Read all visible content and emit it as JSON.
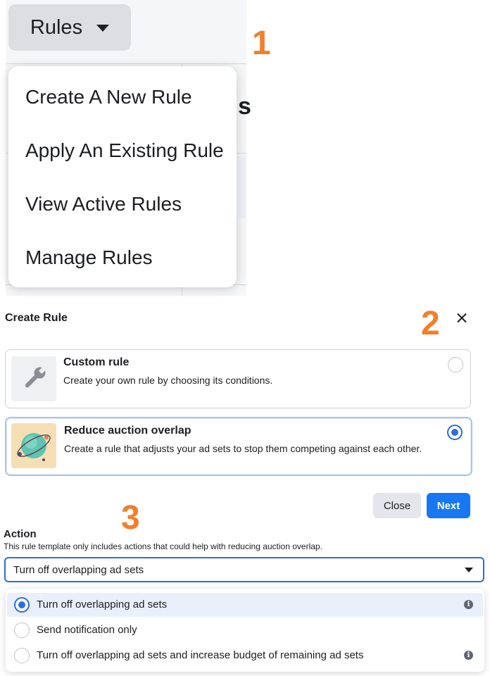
{
  "rules_menu": {
    "button_label": "Rules",
    "items": [
      "Create A New Rule",
      "Apply An Existing Rule",
      "View Active Rules",
      "Manage Rules"
    ],
    "partial_background_glyph": "s"
  },
  "step_numbers": [
    "1",
    "2",
    "3"
  ],
  "create_rule_modal": {
    "title": "Create Rule",
    "options": [
      {
        "title": "Custom rule",
        "description": "Create your own rule by choosing its conditions.",
        "icon": "wrench-icon",
        "selected": false
      },
      {
        "title": "Reduce auction overlap",
        "description": "Create a rule that adjusts your ad sets to stop them competing against each other.",
        "icon": "overlap-illustration-icon",
        "selected": true
      }
    ],
    "close_button": "Close",
    "next_button": "Next"
  },
  "action": {
    "label": "Action",
    "help_text": "This rule template only includes actions that could help with reducing auction overlap.",
    "selected_value": "Turn off overlapping ad sets",
    "options": [
      {
        "label": "Turn off overlapping ad sets",
        "selected": true,
        "info": true
      },
      {
        "label": "Send notification only",
        "selected": false,
        "info": false
      },
      {
        "label": "Turn off overlapping ad sets and increase budget of remaining ad sets",
        "selected": false,
        "info": true
      }
    ]
  },
  "colors": {
    "accent": "#1877f2",
    "step_number": "#f0802c",
    "radio_selected": "#2d6cdf"
  }
}
